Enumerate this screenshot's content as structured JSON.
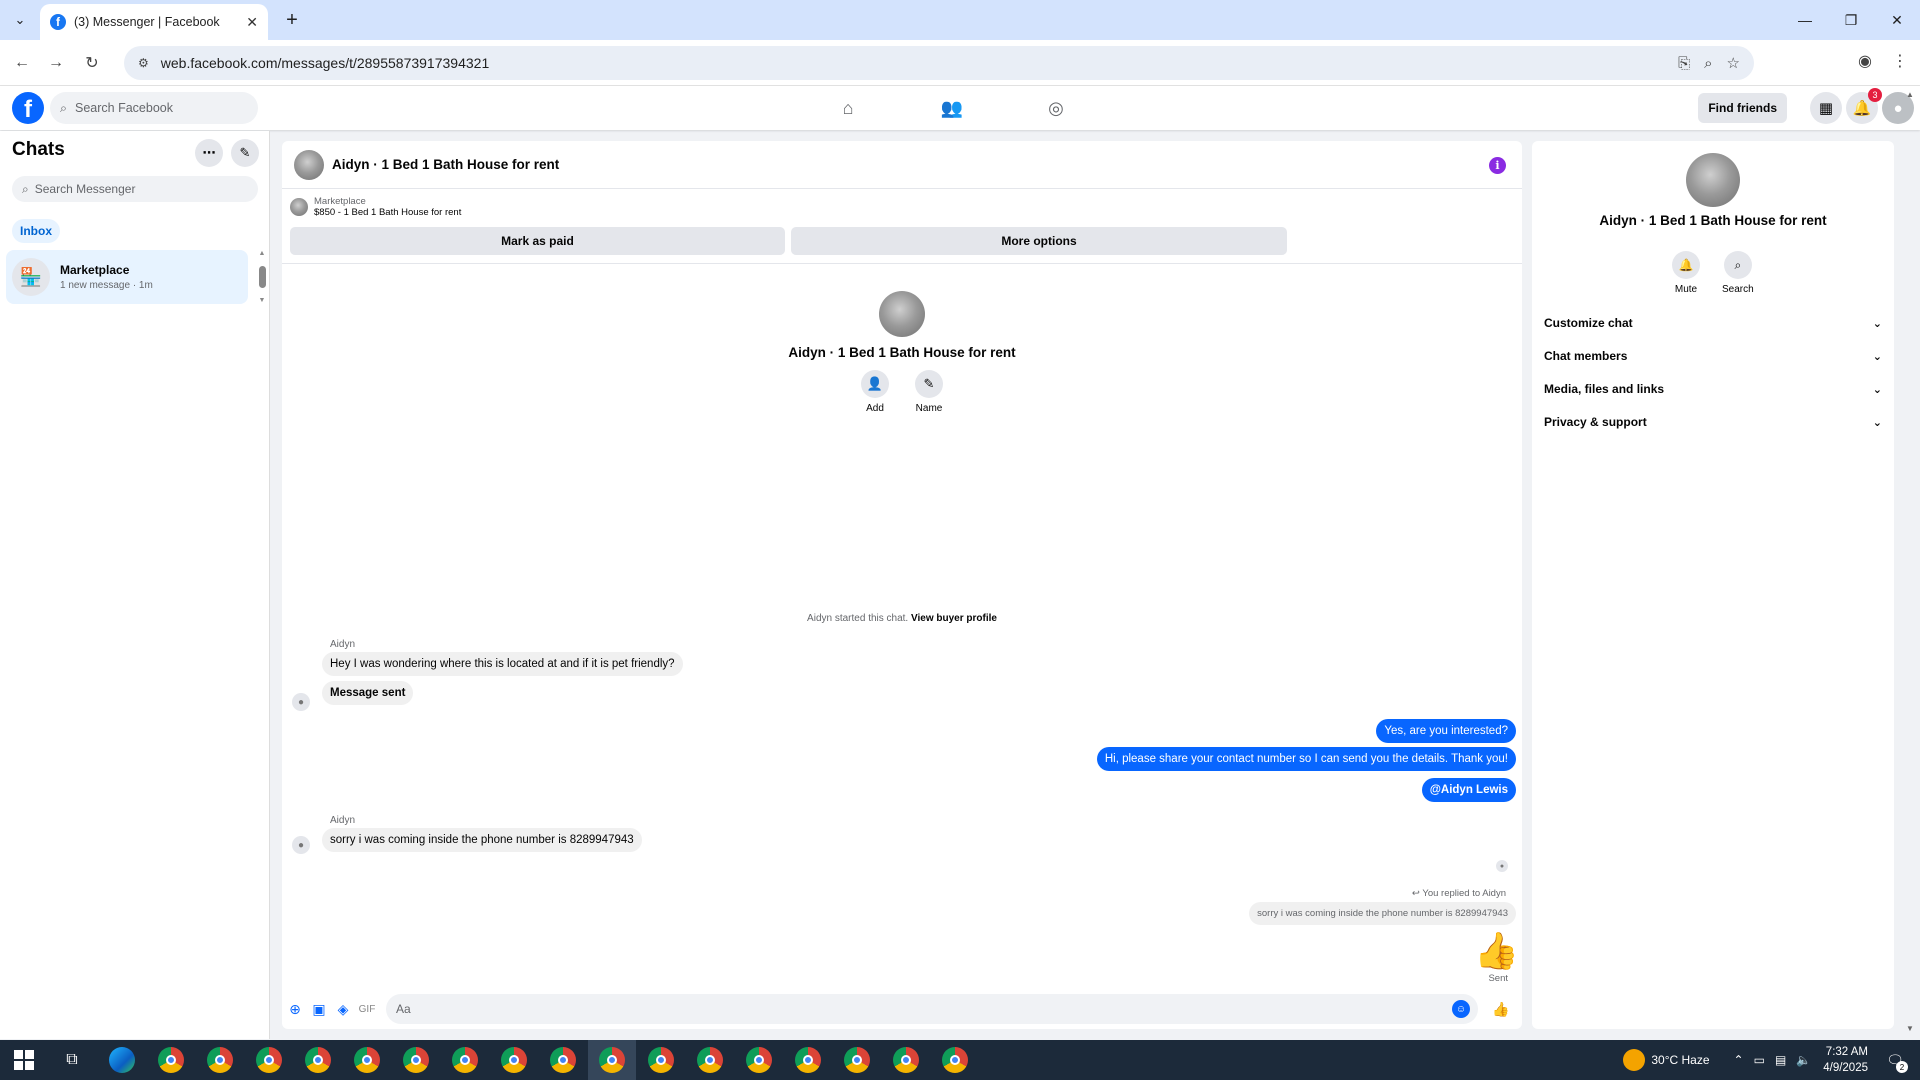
{
  "browser": {
    "tab_title": "(3) Messenger | Facebook",
    "url": "web.facebook.com/messages/t/28955873917394321"
  },
  "fb_header": {
    "search_placeholder": "Search Facebook",
    "find_friends_label": "Find friends",
    "notification_count": "3"
  },
  "chats_panel": {
    "title": "Chats",
    "search_placeholder": "Search Messenger",
    "inbox_label": "Inbox",
    "conversations": [
      {
        "name": "Marketplace",
        "subtitle": "1 new message · 1m"
      }
    ]
  },
  "conversation": {
    "title": "Aidyn · 1 Bed 1 Bath House for rent",
    "marketplace_label": "Marketplace",
    "listing": "$850 - 1 Bed 1 Bath House for rent",
    "mark_paid_label": "Mark as paid",
    "more_options_label": "More options",
    "intro_actions": {
      "add": "Add",
      "name": "Name"
    },
    "started_text": "Aidyn started this chat.",
    "view_buyer_profile": "View buyer profile",
    "messages": {
      "sender_name": "Aidyn",
      "in_1": "Hey I was wondering where this is located at and if it is pet friendly?",
      "in_2": "Message sent",
      "out_1": "Yes, are you interested?",
      "out_2": "Hi, please share your contact number so I can send you the details. Thank you!",
      "out_3": "@Aidyn Lewis",
      "in_3": "sorry i was coming inside the phone number is 8289947943",
      "replied_label": "You replied to Aidyn",
      "quoted": "sorry i was coming inside the phone number is 8289947943",
      "sent_label": "Sent"
    },
    "composer_placeholder": "Aa"
  },
  "info_panel": {
    "title": "Aidyn · 1 Bed 1 Bath House for rent",
    "mute_label": "Mute",
    "search_label": "Search",
    "sections": [
      "Customize chat",
      "Chat members",
      "Media, files and links",
      "Privacy & support"
    ]
  },
  "taskbar": {
    "weather": "30°C  Haze",
    "time": "7:32 AM",
    "date": "4/9/2025",
    "notification_count": "2"
  },
  "colors": {
    "fb_blue": "#0866ff",
    "outgoing_bubble": "#0866ff",
    "incoming_bubble": "#f0f0f0",
    "info_icon": "#8a2be2",
    "tab_strip": "#d3e3fd"
  }
}
